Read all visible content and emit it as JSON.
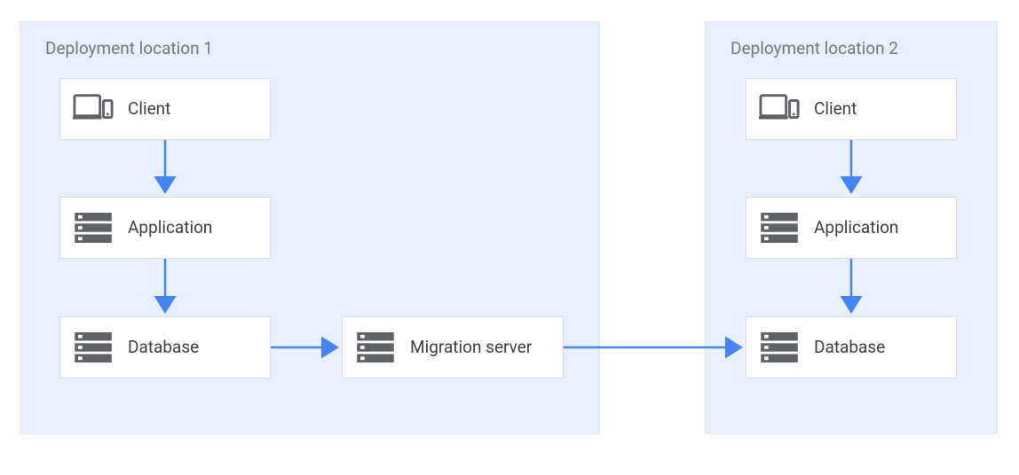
{
  "regions": {
    "loc1": {
      "label": "Deployment location 1"
    },
    "loc2": {
      "label": "Deployment location 2"
    }
  },
  "nodes": {
    "client1": {
      "label": "Client"
    },
    "app1": {
      "label": "Application"
    },
    "db1": {
      "label": "Database"
    },
    "migration": {
      "label": "Migration server"
    },
    "client2": {
      "label": "Client"
    },
    "app2": {
      "label": "Application"
    },
    "db2": {
      "label": "Database"
    }
  },
  "colors": {
    "region_bg": "#e8f0fe",
    "arrow": "#4285f4",
    "icon": "#5f6368"
  }
}
